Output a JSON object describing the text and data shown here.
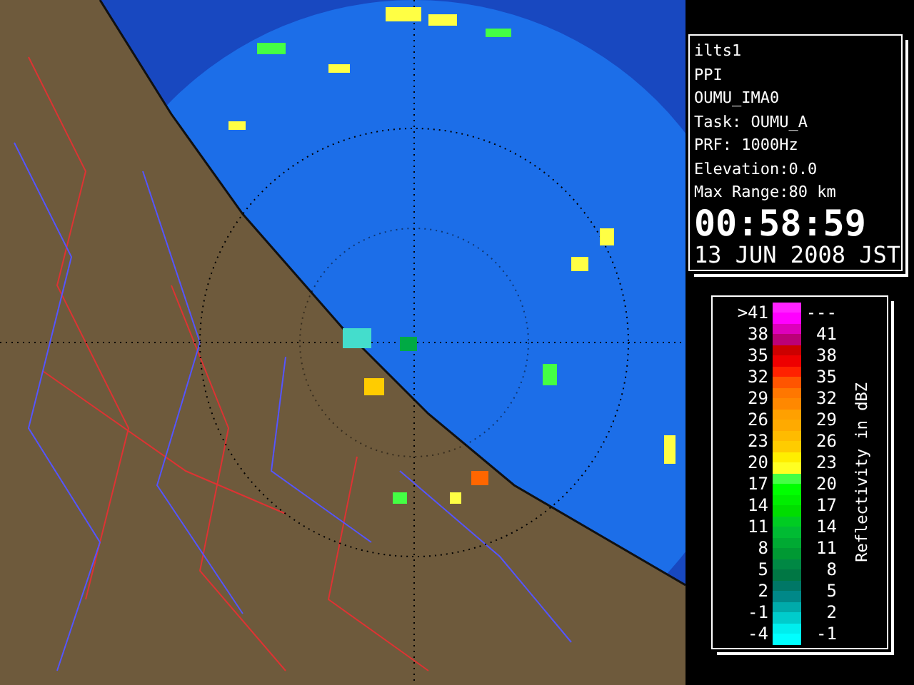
{
  "info": {
    "lines": [
      "ilts1",
      "PPI",
      "OUMU_IMA0",
      "Task: OUMU_A",
      "PRF: 1000Hz",
      "Elevation:0.0",
      "Max Range:80 km"
    ],
    "time": "00:58:59",
    "date": "13 JUN 2008 JST"
  },
  "legend": {
    "axis_label": "Reflectivity in dBZ",
    "rows": [
      {
        "low": ">41",
        "high": "---",
        "swatches": [
          {
            "color": "#ff22ff"
          },
          {
            "color": "#ff00ff"
          }
        ]
      },
      {
        "low": "38",
        "high": "41",
        "swatches": [
          {
            "color": "#dd00bb"
          },
          {
            "color": "#bb0077"
          }
        ]
      },
      {
        "low": "35",
        "high": "38",
        "swatches": [
          {
            "color": "#cc0000"
          },
          {
            "color": "#ee0000"
          }
        ]
      },
      {
        "low": "32",
        "high": "35",
        "swatches": [
          {
            "color": "#ff2200"
          },
          {
            "color": "#ff5500"
          }
        ]
      },
      {
        "low": "29",
        "high": "32",
        "swatches": [
          {
            "color": "#ff7700"
          },
          {
            "color": "#ff8800"
          }
        ]
      },
      {
        "low": "26",
        "high": "29",
        "swatches": [
          {
            "color": "#ffa000"
          },
          {
            "color": "#ffaa00"
          }
        ]
      },
      {
        "low": "23",
        "high": "26",
        "swatches": [
          {
            "color": "#ffbb00"
          },
          {
            "color": "#ffcc00"
          }
        ]
      },
      {
        "low": "20",
        "high": "23",
        "swatches": [
          {
            "color": "#ffee00"
          },
          {
            "color": "#ffff22"
          }
        ]
      },
      {
        "low": "17",
        "high": "20",
        "swatches": [
          {
            "color": "#44ff44"
          },
          {
            "color": "#00ff00"
          }
        ]
      },
      {
        "low": "14",
        "high": "17",
        "swatches": [
          {
            "color": "#00ee00"
          },
          {
            "color": "#00dd00"
          }
        ]
      },
      {
        "low": "11",
        "high": "14",
        "swatches": [
          {
            "color": "#00cc22"
          },
          {
            "color": "#00bb33"
          }
        ]
      },
      {
        "low": "8",
        "high": "11",
        "swatches": [
          {
            "color": "#00aa33"
          },
          {
            "color": "#009933"
          }
        ]
      },
      {
        "low": "5",
        "high": "8",
        "swatches": [
          {
            "color": "#008844"
          },
          {
            "color": "#007744"
          }
        ]
      },
      {
        "low": "2",
        "high": "5",
        "swatches": [
          {
            "color": "#007766"
          },
          {
            "color": "#008888"
          }
        ]
      },
      {
        "low": "-1",
        "high": "2",
        "swatches": [
          {
            "color": "#00aaaa"
          },
          {
            "color": "#00cccc"
          }
        ]
      },
      {
        "low": "-4",
        "high": "-1",
        "swatches": [
          {
            "color": "#00eeee"
          },
          {
            "color": "#00ffff"
          }
        ]
      }
    ]
  }
}
